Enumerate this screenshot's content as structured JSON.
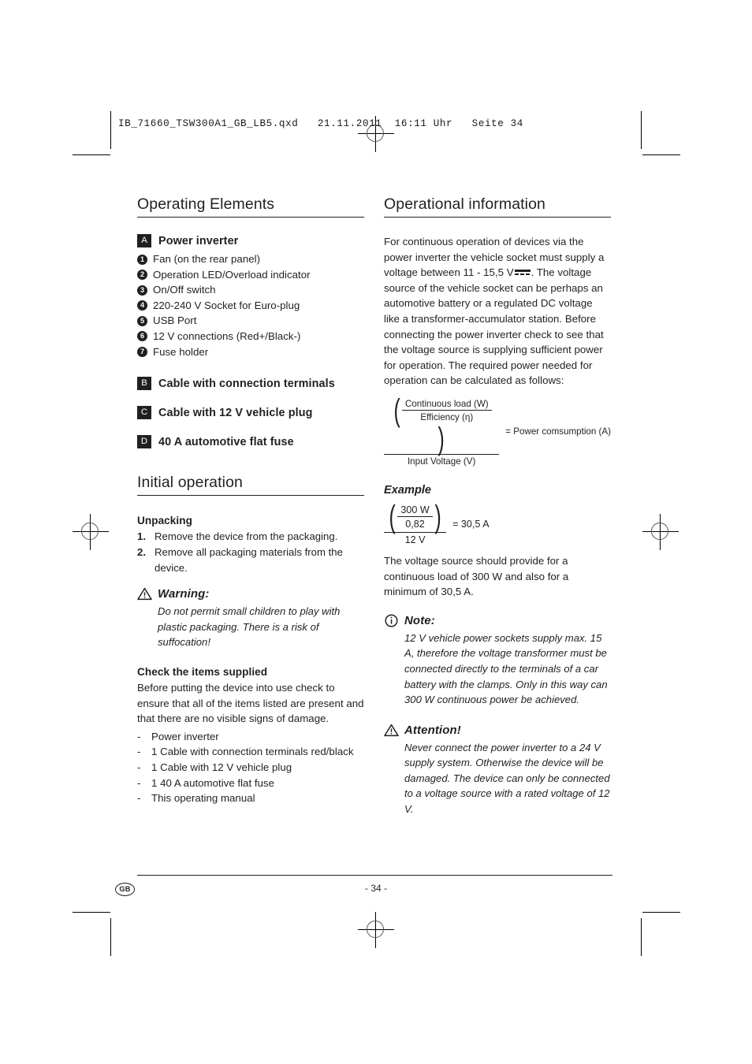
{
  "header": {
    "file_line": "IB_71660_TSW300A1_GB_LB5.qxd   21.11.2011  16:11 Uhr   Seite 34"
  },
  "left_column": {
    "section_title": "Operating Elements",
    "group_a": {
      "badge": "A",
      "label": "Power inverter",
      "items": [
        {
          "num": "1",
          "text": "Fan (on the rear panel)"
        },
        {
          "num": "2",
          "text": "Operation LED/Overload indicator"
        },
        {
          "num": "3",
          "text": "On/Off switch"
        },
        {
          "num": "4",
          "text": "220-240 V Socket for Euro-plug"
        },
        {
          "num": "5",
          "text": "USB Port"
        },
        {
          "num": "6",
          "text": "12 V connections (Red+/Black-)"
        },
        {
          "num": "7",
          "text": "Fuse holder"
        }
      ]
    },
    "group_b": {
      "badge": "B",
      "label": "Cable with connection terminals"
    },
    "group_c": {
      "badge": "C",
      "label": "Cable with 12 V vehicle plug"
    },
    "group_d": {
      "badge": "D",
      "label": "40 A automotive flat fuse"
    },
    "initial_operation_title": "Initial operation",
    "unpacking": {
      "heading": "Unpacking",
      "steps": [
        {
          "num": "1.",
          "text": "Remove the device from the packaging."
        },
        {
          "num": "2.",
          "text": "Remove all packaging materials from the device."
        }
      ]
    },
    "warning": {
      "title": "Warning:",
      "body": "Do not permit small children to play with plastic packaging. There is a risk of suffocation!"
    },
    "check_items": {
      "heading": "Check the items supplied",
      "intro": "Before putting the device into use check to ensure that all of the items listed are present and that there are no visible signs of damage.",
      "dash": "-",
      "items": [
        "Power inverter",
        "1 Cable with connection terminals red/black",
        "1 Cable with 12 V vehicle plug",
        "1 40 A automotive flat fuse",
        "This operating manual"
      ]
    }
  },
  "right_column": {
    "section_title": "Operational information",
    "intro_part1": "For continuous operation of devices via the power inverter the vehicle socket must supply a voltage between 11 - 15,5 V",
    "intro_part2": ". The voltage source of the vehicle socket can be perhaps an automotive battery or a regulated DC voltage like a transformer-accumulator station. Before connecting the power inverter check to see that the voltage source is supplying sufficient power for operation. The required power needed for operation can be calculated as follows:",
    "formula": {
      "numerator_top": "Continuous load (W)",
      "numerator_bottom": "Efficiency (η)",
      "denominator": "Input Voltage (V)",
      "result_label": "= Power comsumption (A)"
    },
    "example": {
      "heading": "Example",
      "numerator_top": "300 W",
      "numerator_bottom": "0,82",
      "denominator": "12 V",
      "result_label": "= 30,5 A",
      "explanation": "The voltage source should provide for a continuous load of 300 W and also for a minimum of 30,5 A."
    },
    "note": {
      "title": "Note:",
      "body": "12 V vehicle power sockets supply max. 15 A, therefore the voltage transformer must be connected directly to the terminals of a car battery with the clamps. Only in this way can 300 W continuous power be achieved."
    },
    "attention": {
      "title": "Attention!",
      "body": "Never connect the power inverter to a 24 V supply system. Otherwise the device will be damaged. The device can only be connected to a voltage source with a rated voltage of 12 V."
    }
  },
  "footer": {
    "locale_badge": "GB",
    "page_number": "- 34 -"
  }
}
